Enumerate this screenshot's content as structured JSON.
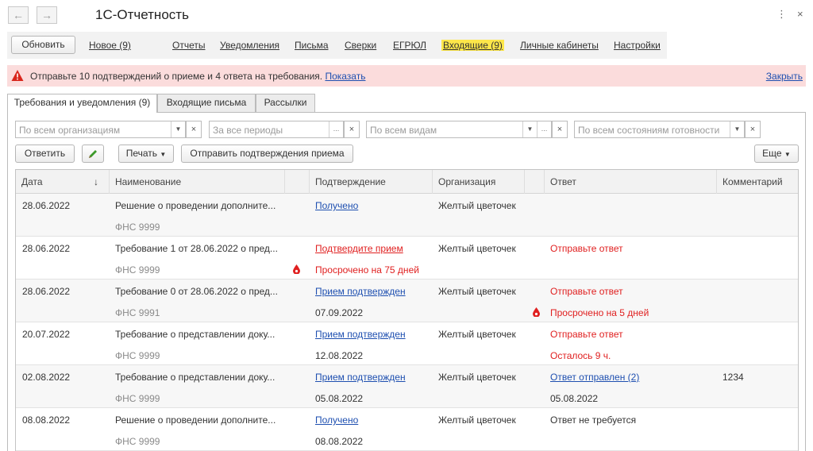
{
  "window": {
    "title": "1С-Отчетность",
    "more_icon": "⋮",
    "close_icon": "×"
  },
  "menu": {
    "refresh": "Обновить",
    "items": [
      {
        "label": "Новое (9)"
      },
      {
        "label": "Отчеты"
      },
      {
        "label": "Уведомления"
      },
      {
        "label": "Письма"
      },
      {
        "label": "Сверки"
      },
      {
        "label": "ЕГРЮЛ"
      },
      {
        "label": "Входящие (9)"
      },
      {
        "label": "Личные кабинеты"
      },
      {
        "label": "Настройки"
      }
    ]
  },
  "alert": {
    "text": "Отправьте 10 подтверждений о приеме и 4 ответа на требования.",
    "link": "Показать",
    "close": "Закрыть"
  },
  "tabs": [
    "Требования и уведомления (9)",
    "Входящие письма",
    "Рассылки"
  ],
  "filters": {
    "org": "По всем организациям",
    "period": "За все периоды",
    "kind": "По всем видам",
    "state": "По всем состояниям готовности"
  },
  "toolbar": {
    "reply": "Ответить",
    "print": "Печать",
    "send_confirm": "Отправить подтверждения приема",
    "more": "Еще"
  },
  "table": {
    "headers": [
      "Дата",
      "Наименование",
      "Подтверждение",
      "Организация",
      "Ответ",
      "Комментарий"
    ],
    "sort_icon": "↓",
    "rows": [
      {
        "date": "28.06.2022",
        "name": "Решение о проведении дополните...",
        "sender": "ФНС 9999",
        "confirm": "Получено",
        "confirm2": "",
        "org": "Желтый цветочек",
        "answer": "",
        "answer2": "",
        "comment": ""
      },
      {
        "date": "28.06.2022",
        "name": "Требование 1 от 28.06.2022 о пред...",
        "sender": "ФНС 9999",
        "confirm": "Подтвердите прием",
        "confirm2": "Просрочено на 75 дней",
        "org": "Желтый цветочек",
        "answer": "Отправьте ответ",
        "answer2": "",
        "comment": ""
      },
      {
        "date": "28.06.2022",
        "name": "Требование 0 от 28.06.2022 о пред...",
        "sender": "ФНС 9991",
        "confirm": "Прием подтвержден",
        "confirm2": "07.09.2022",
        "org": "Желтый цветочек",
        "answer": "Отправьте ответ",
        "answer2": "Просрочено на 5 дней",
        "comment": ""
      },
      {
        "date": "20.07.2022",
        "name": "Требование о представлении доку...",
        "sender": "ФНС 9999",
        "confirm": "Прием подтвержден",
        "confirm2": "12.08.2022",
        "org": "Желтый цветочек",
        "answer": "Отправьте ответ",
        "answer2": "Осталось 9 ч.",
        "comment": ""
      },
      {
        "date": "02.08.2022",
        "name": "Требование о представлении доку...",
        "sender": "ФНС 9999",
        "confirm": "Прием подтвержден",
        "confirm2": "05.08.2022",
        "org": "Желтый цветочек",
        "answer": "Ответ отправлен (2)",
        "answer2": "05.08.2022",
        "comment": "1234"
      },
      {
        "date": "08.08.2022",
        "name": "Решение о проведении дополните...",
        "sender": "ФНС 9999",
        "confirm": "Получено",
        "confirm2": "08.08.2022",
        "org": "Желтый цветочек",
        "answer": "Ответ не требуется",
        "answer2": "",
        "comment": ""
      }
    ]
  },
  "colors": {
    "link": "#1e4fb0",
    "alert_bg": "#fbdcdc",
    "highlight": "#fde74a",
    "warning": "#e02020"
  }
}
